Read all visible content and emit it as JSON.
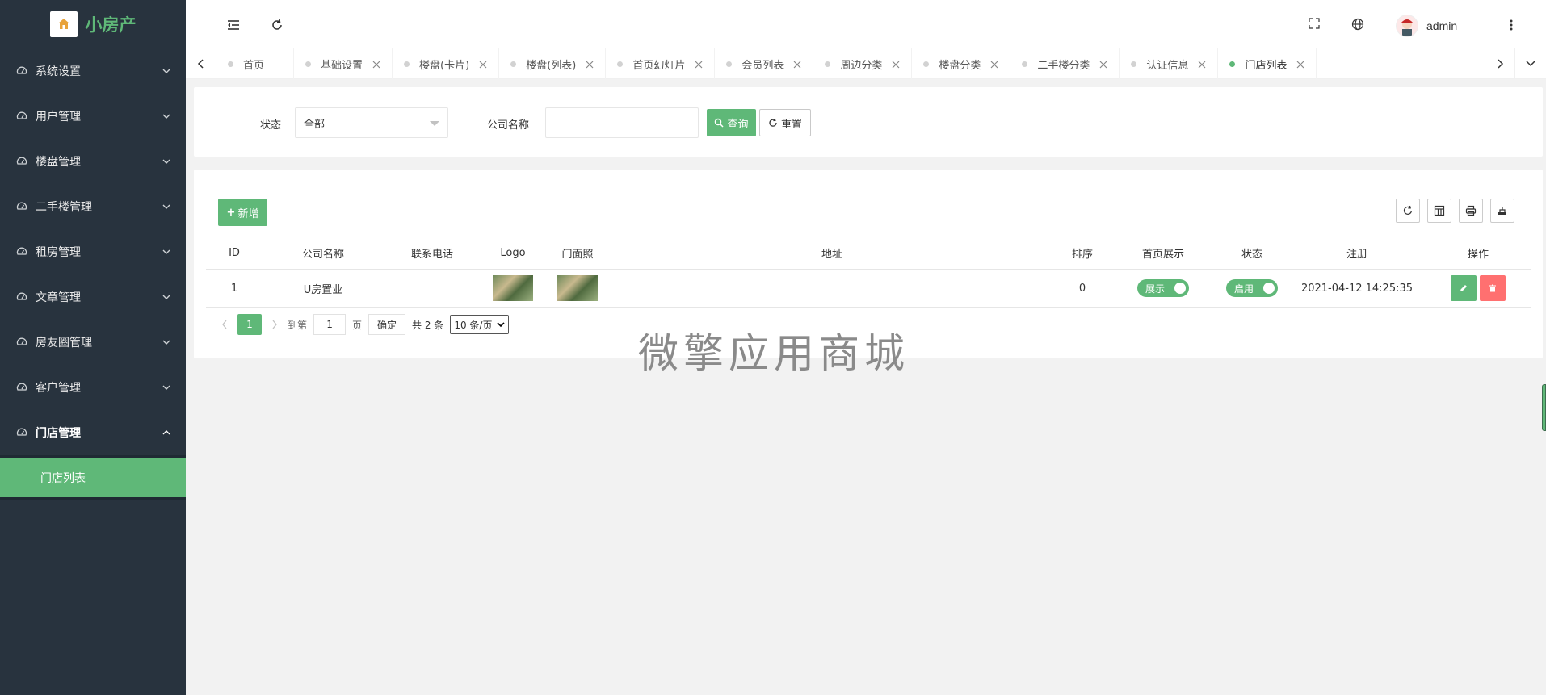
{
  "app": {
    "title": "小房产",
    "logo_glyph": "🏠"
  },
  "sidebar": {
    "items": [
      {
        "label": "系统设置"
      },
      {
        "label": "用户管理"
      },
      {
        "label": "楼盘管理"
      },
      {
        "label": "二手楼管理"
      },
      {
        "label": "租房管理"
      },
      {
        "label": "文章管理"
      },
      {
        "label": "房友圈管理"
      },
      {
        "label": "客户管理"
      },
      {
        "label": "门店管理"
      }
    ],
    "sub_items": [
      {
        "label": "门店列表"
      }
    ]
  },
  "header": {
    "user": "admin"
  },
  "tabs": [
    {
      "label": "首页",
      "closable": false
    },
    {
      "label": "基础设置",
      "closable": true
    },
    {
      "label": "楼盘(卡片)",
      "closable": true
    },
    {
      "label": "楼盘(列表)",
      "closable": true
    },
    {
      "label": "首页幻灯片",
      "closable": true
    },
    {
      "label": "会员列表",
      "closable": true
    },
    {
      "label": "周边分类",
      "closable": true
    },
    {
      "label": "楼盘分类",
      "closable": true
    },
    {
      "label": "二手楼分类",
      "closable": true
    },
    {
      "label": "认证信息",
      "closable": true
    },
    {
      "label": "门店列表",
      "closable": true,
      "active": true
    }
  ],
  "filter": {
    "status_label": "状态",
    "status_value": "全部",
    "company_label": "公司名称",
    "company_value": "",
    "search_label": "查询",
    "reset_label": "重置"
  },
  "table": {
    "add_label": "新增",
    "columns": [
      "ID",
      "公司名称",
      "联系电话",
      "Logo",
      "门面照",
      "地址",
      "排序",
      "首页展示",
      "状态",
      "注册",
      "操作"
    ],
    "rows": [
      {
        "id": "1",
        "company": "U房置业",
        "phone": "",
        "address": "",
        "sort": "0",
        "home_show": "展示",
        "status": "启用",
        "registered": "2021-04-12 14:25:35"
      }
    ]
  },
  "pagination": {
    "current": "1",
    "goto_label": "到第",
    "goto_value": "1",
    "page_unit": "页",
    "confirm_label": "确定",
    "total": "共 2 条",
    "page_size": "10 条/页"
  },
  "watermark": "微擎应用商城",
  "colors": {
    "accent": "#5fb878",
    "sidebar_bg": "#28333e",
    "danger": "#ff7070"
  }
}
